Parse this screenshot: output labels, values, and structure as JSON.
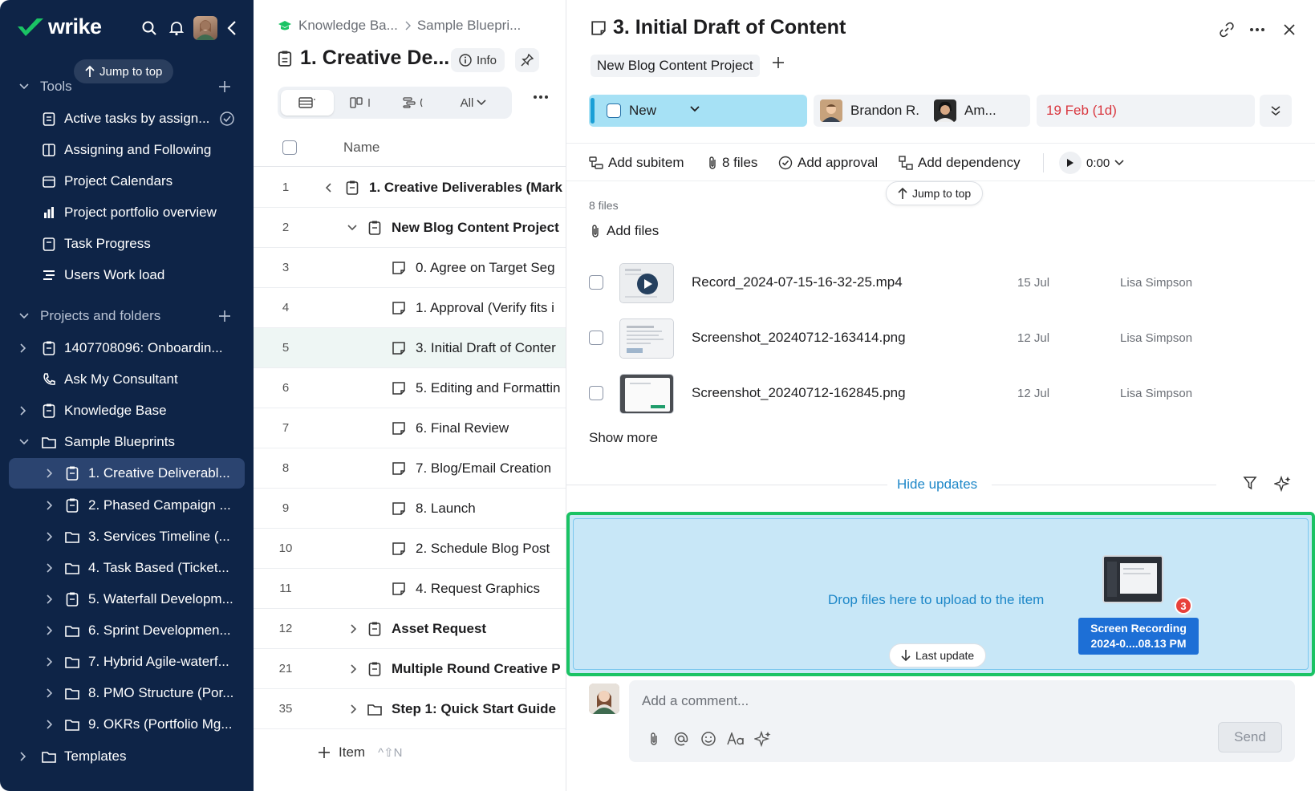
{
  "brand": {
    "name": "wrike",
    "accent": "#1ac364"
  },
  "sidebar": {
    "jump_to_top": "Jump to top",
    "tools_section": "Tools",
    "tools": [
      {
        "label": "Active tasks by assign...",
        "icon": "report-icon"
      },
      {
        "label": "Assigning and Following",
        "icon": "board-icon"
      },
      {
        "label": "Project Calendars",
        "icon": "calendar-icon"
      },
      {
        "label": "Project portfolio overview",
        "icon": "portfolio-icon"
      },
      {
        "label": "Task Progress",
        "icon": "report-icon"
      },
      {
        "label": "Users Work load",
        "icon": "workload-icon"
      }
    ],
    "projects_section": "Projects and folders",
    "projects": [
      {
        "label": "1407708096: Onboardin...",
        "icon": "project-icon"
      },
      {
        "label": "Ask My Consultant",
        "icon": "phone-icon"
      },
      {
        "label": "Knowledge Base",
        "icon": "project-icon"
      },
      {
        "label": "Sample Blueprints",
        "icon": "folder-icon"
      },
      {
        "label": "1. Creative Deliverabl...",
        "icon": "project-icon"
      },
      {
        "label": "2. Phased Campaign ...",
        "icon": "project-icon"
      },
      {
        "label": "3. Services Timeline (...",
        "icon": "folder-icon"
      },
      {
        "label": "4. Task Based (Ticket...",
        "icon": "folder-icon"
      },
      {
        "label": "5. Waterfall Developm...",
        "icon": "project-icon"
      },
      {
        "label": "6. Sprint Developmen...",
        "icon": "folder-icon"
      },
      {
        "label": "7. Hybrid Agile-waterf...",
        "icon": "folder-icon"
      },
      {
        "label": "8. PMO Structure (Por...",
        "icon": "folder-icon"
      },
      {
        "label": "9. OKRs (Portfolio Mg...",
        "icon": "folder-icon"
      },
      {
        "label": "Templates",
        "icon": "folder-icon"
      }
    ]
  },
  "middle": {
    "breadcrumb": [
      "Knowledge Ba...",
      "Sample Bluepri..."
    ],
    "title": "1. Creative De...",
    "info_label": "Info",
    "view_filter": "All",
    "name_header": "Name",
    "rows": [
      {
        "num": "1",
        "label": "1. Creative Deliverables (Mark",
        "bold": true
      },
      {
        "num": "2",
        "label": "New Blog Content Project",
        "bold": true
      },
      {
        "num": "3",
        "label": "0. Agree on Target Seg"
      },
      {
        "num": "4",
        "label": "1. Approval (Verify fits i"
      },
      {
        "num": "5",
        "label": "3. Initial Draft of Conter"
      },
      {
        "num": "6",
        "label": "5. Editing and Formattin"
      },
      {
        "num": "7",
        "label": "6. Final Review"
      },
      {
        "num": "8",
        "label": "7. Blog/Email Creation"
      },
      {
        "num": "9",
        "label": "8. Launch"
      },
      {
        "num": "10",
        "label": "2. Schedule Blog Post"
      },
      {
        "num": "11",
        "label": "4. Request Graphics"
      },
      {
        "num": "12",
        "label": "Asset Request",
        "bold": true
      },
      {
        "num": "21",
        "label": "Multiple Round Creative P",
        "bold": true
      },
      {
        "num": "35",
        "label": "Step 1: Quick Start Guide",
        "bold": true
      }
    ],
    "add_item": "Item",
    "add_item_shortcut": "^⇧N"
  },
  "detail": {
    "title": "3. Initial Draft of Content",
    "project_tag": "New Blog Content Project",
    "status": "New",
    "status_color": "#a6e1f5",
    "assignee_1": "Brandon R.",
    "assignee_2": "Am...",
    "due_date": "19 Feb (1d)",
    "actions": {
      "add_subitem": "Add subitem",
      "files": "8 files",
      "add_approval": "Add approval",
      "add_dependency": "Add dependency",
      "timer": "0:00"
    },
    "jump_to_top": "Jump to top",
    "files_count": "8 files",
    "add_files": "Add files",
    "files": [
      {
        "name": "Record_2024-07-15-16-32-25.mp4",
        "date": "15 Jul",
        "user": "Lisa Simpson"
      },
      {
        "name": "Screenshot_20240712-163414.png",
        "date": "12 Jul",
        "user": "Lisa Simpson"
      },
      {
        "name": "Screenshot_20240712-162845.png",
        "date": "12 Jul",
        "user": "Lisa Simpson"
      }
    ],
    "show_more": "Show more",
    "hide_updates": "Hide updates",
    "drop_text": "Drop files here to upload to the item",
    "drag_badge": "3",
    "drag_label_1": "Screen Recording",
    "drag_label_2": "2024-0....08.13 PM",
    "last_update": "Last update",
    "comment_placeholder": "Add a comment...",
    "send": "Send"
  }
}
